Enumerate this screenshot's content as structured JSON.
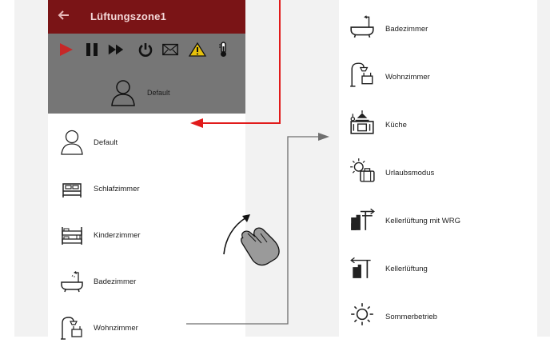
{
  "app": {
    "title": "Lüftungszone1",
    "current_profile": "Default",
    "controls": [
      "play-icon",
      "pause-icon",
      "fast-forward-icon",
      "power-icon",
      "mail-icon",
      "warning-icon",
      "thermometer-icon"
    ]
  },
  "left_list": {
    "items": [
      {
        "label": "Default",
        "icon": "person-icon"
      },
      {
        "label": "Schlafzimmer",
        "icon": "bed-icon"
      },
      {
        "label": "Kinderzimmer",
        "icon": "bunk-bed-icon"
      },
      {
        "label": "Badezimmer",
        "icon": "bathtub-icon"
      },
      {
        "label": "Wohnzimmer",
        "icon": "floor-lamp-armchair-icon"
      }
    ]
  },
  "right_list": {
    "items": [
      {
        "label": "Badezimmer",
        "icon": "bathtub-icon"
      },
      {
        "label": "Wohnzimmer",
        "icon": "floor-lamp-armchair-icon"
      },
      {
        "label": "Küche",
        "icon": "kitchen-icon"
      },
      {
        "label": "Urlaubsmodus",
        "icon": "sun-suitcase-icon"
      },
      {
        "label": "Kellerlüftung mit WRG",
        "icon": "cellar-ventilation-wrg-icon"
      },
      {
        "label": "Kellerlüftung",
        "icon": "cellar-ventilation-icon"
      },
      {
        "label": "Sommerbetrieb",
        "icon": "sun-icon"
      }
    ]
  },
  "colors": {
    "titlebar": "#7a1416",
    "accent_red": "#e11b1b",
    "control_red": "#c62828",
    "panel_gray": "#767676",
    "connector_gray": "#6f6f6f"
  }
}
